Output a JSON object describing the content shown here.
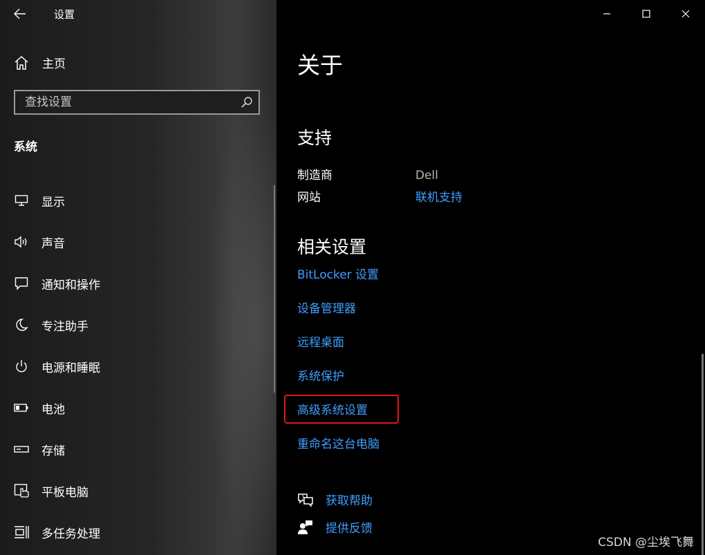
{
  "window": {
    "title": "设置",
    "controls": {
      "minimize": "minimize",
      "maximize": "maximize",
      "close": "close"
    }
  },
  "sidebar": {
    "home_label": "主页",
    "search_placeholder": "查找设置",
    "section_title": "系统",
    "items": [
      {
        "label": "显示",
        "icon": "monitor-icon"
      },
      {
        "label": "声音",
        "icon": "speaker-icon"
      },
      {
        "label": "通知和操作",
        "icon": "notification-icon"
      },
      {
        "label": "专注助手",
        "icon": "moon-icon"
      },
      {
        "label": "电源和睡眠",
        "icon": "power-icon"
      },
      {
        "label": "电池",
        "icon": "battery-icon"
      },
      {
        "label": "存储",
        "icon": "storage-icon"
      },
      {
        "label": "平板电脑",
        "icon": "tablet-icon"
      },
      {
        "label": "多任务处理",
        "icon": "multitask-icon"
      }
    ]
  },
  "main": {
    "page_title": "关于",
    "support": {
      "title": "支持",
      "rows": [
        {
          "key": "制造商",
          "value": "Dell"
        },
        {
          "key": "网站",
          "value": "联机支持"
        }
      ]
    },
    "related": {
      "title": "相关设置",
      "links": [
        "BitLocker 设置",
        "设备管理器",
        "远程桌面",
        "系统保护",
        "高级系统设置",
        "重命名这台电脑"
      ]
    },
    "help": {
      "get_help": "获取帮助",
      "feedback": "提供反馈"
    }
  },
  "highlight_color": "#e01818",
  "link_color": "#3f9eff",
  "watermark": "CSDN @尘埃飞舞"
}
